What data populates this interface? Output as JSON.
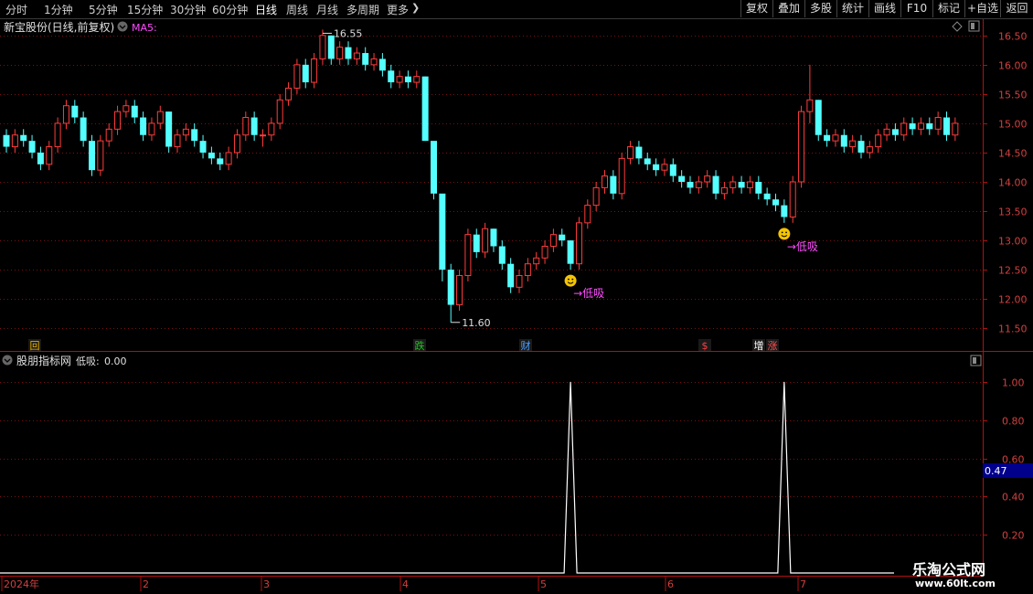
{
  "toolbar": {
    "periods": [
      "分时",
      "1分钟",
      "5分钟",
      "15分钟",
      "30分钟",
      "60分钟",
      "日线",
      "周线",
      "月线",
      "多周期",
      "更多"
    ],
    "active_period": "日线",
    "buttons": [
      "复权",
      "叠加",
      "多股",
      "统计",
      "画线",
      "F10",
      "标记",
      "+自选",
      "返回"
    ]
  },
  "main_chart": {
    "title": "新宝股份(日线,前复权)",
    "indicator": "MA5:",
    "high_label": "16.55",
    "low_label": "11.60",
    "signal_text": "低吸",
    "signal_arrow": "→",
    "price_ticks": [
      "16.50",
      "16.00",
      "15.50",
      "15.00",
      "14.50",
      "14.00",
      "13.50",
      "13.00",
      "12.50",
      "12.00",
      "11.50"
    ],
    "events": [
      {
        "text": "回",
        "color": "#e8b400"
      },
      {
        "text": "跌",
        "color": "#22c022"
      },
      {
        "text": "财",
        "color": "#4aa0ff"
      },
      {
        "text": "$",
        "color": "#ff4040"
      },
      {
        "text": "增",
        "color": "#ffffff"
      },
      {
        "text": "涨",
        "color": "#ff5050"
      }
    ]
  },
  "sub_chart": {
    "title": "股朋指标网",
    "indicator_label": "低吸:",
    "indicator_value": "0.00",
    "ticks": [
      "1.00",
      "0.80",
      "0.60",
      "0.40",
      "0.20"
    ],
    "current_value": "0.47"
  },
  "time_axis": {
    "labels": [
      "2024年",
      "2",
      "3",
      "4",
      "5",
      "6",
      "7"
    ]
  },
  "watermark": {
    "line1": "乐淘公式网",
    "line2": "www.60lt.com"
  },
  "chart_data": {
    "type": "candlestick",
    "security": "新宝股份",
    "period": "日线",
    "price_range": [
      11.3,
      16.7
    ],
    "up_color": "#ff3c3c",
    "down_color": "#54ffff",
    "candles": [
      [
        14.8,
        14.6,
        14.9,
        14.5
      ],
      [
        14.6,
        14.8,
        14.9,
        14.5
      ],
      [
        14.8,
        14.7,
        14.9,
        14.6
      ],
      [
        14.7,
        14.5,
        14.8,
        14.4
      ],
      [
        14.5,
        14.3,
        14.6,
        14.2
      ],
      [
        14.3,
        14.6,
        14.7,
        14.2
      ],
      [
        14.6,
        15.0,
        15.1,
        14.5
      ],
      [
        15.0,
        15.3,
        15.4,
        14.9
      ],
      [
        15.3,
        15.1,
        15.4,
        15.0
      ],
      [
        15.1,
        14.7,
        15.2,
        14.6
      ],
      [
        14.7,
        14.2,
        14.8,
        14.1
      ],
      [
        14.2,
        14.7,
        14.8,
        14.1
      ],
      [
        14.7,
        14.9,
        15.0,
        14.6
      ],
      [
        14.9,
        15.2,
        15.3,
        14.8
      ],
      [
        15.2,
        15.3,
        15.4,
        15.1
      ],
      [
        15.3,
        15.1,
        15.4,
        15.0
      ],
      [
        15.1,
        14.8,
        15.2,
        14.7
      ],
      [
        14.8,
        15.0,
        15.1,
        14.7
      ],
      [
        15.0,
        15.2,
        15.3,
        14.9
      ],
      [
        15.2,
        14.6,
        15.2,
        14.5
      ],
      [
        14.6,
        14.8,
        14.9,
        14.5
      ],
      [
        14.8,
        14.9,
        15.0,
        14.7
      ],
      [
        14.9,
        14.7,
        15.0,
        14.6
      ],
      [
        14.7,
        14.5,
        14.8,
        14.4
      ],
      [
        14.5,
        14.4,
        14.6,
        14.3
      ],
      [
        14.4,
        14.3,
        14.5,
        14.2
      ],
      [
        14.3,
        14.5,
        14.6,
        14.2
      ],
      [
        14.5,
        14.8,
        14.9,
        14.4
      ],
      [
        14.8,
        15.1,
        15.2,
        14.7
      ],
      [
        15.1,
        14.8,
        15.2,
        14.7
      ],
      [
        14.8,
        14.8,
        14.9,
        14.6
      ],
      [
        14.8,
        15.0,
        15.1,
        14.7
      ],
      [
        15.0,
        15.4,
        15.5,
        14.9
      ],
      [
        15.4,
        15.6,
        15.7,
        15.3
      ],
      [
        15.6,
        16.0,
        16.1,
        15.5
      ],
      [
        16.0,
        15.7,
        16.1,
        15.6
      ],
      [
        15.7,
        16.1,
        16.2,
        15.6
      ],
      [
        16.1,
        16.5,
        16.6,
        16.0
      ],
      [
        16.5,
        16.1,
        16.5,
        16.0
      ],
      [
        16.1,
        16.3,
        16.4,
        16.0
      ],
      [
        16.3,
        16.1,
        16.4,
        16.0
      ],
      [
        16.1,
        16.2,
        16.3,
        16.0
      ],
      [
        16.2,
        16.0,
        16.3,
        15.9
      ],
      [
        16.0,
        16.1,
        16.2,
        15.9
      ],
      [
        16.1,
        15.9,
        16.2,
        15.8
      ],
      [
        15.9,
        15.7,
        16.0,
        15.6
      ],
      [
        15.7,
        15.8,
        15.9,
        15.6
      ],
      [
        15.8,
        15.7,
        15.9,
        15.6
      ],
      [
        15.7,
        15.8,
        15.9,
        15.6
      ],
      [
        15.8,
        14.7,
        15.8,
        14.7
      ],
      [
        14.7,
        13.8,
        14.3,
        13.7
      ],
      [
        13.8,
        12.5,
        13.6,
        12.3
      ],
      [
        12.5,
        11.9,
        12.6,
        11.6
      ],
      [
        11.9,
        12.4,
        12.5,
        11.8
      ],
      [
        12.4,
        13.1,
        13.2,
        12.3
      ],
      [
        13.1,
        12.8,
        13.2,
        12.7
      ],
      [
        12.8,
        13.2,
        13.3,
        12.7
      ],
      [
        13.2,
        12.9,
        13.2,
        12.8
      ],
      [
        12.9,
        12.6,
        13.0,
        12.5
      ],
      [
        12.6,
        12.2,
        12.7,
        12.1
      ],
      [
        12.2,
        12.4,
        12.5,
        12.1
      ],
      [
        12.4,
        12.6,
        12.7,
        12.3
      ],
      [
        12.6,
        12.7,
        12.8,
        12.5
      ],
      [
        12.7,
        12.9,
        13.0,
        12.6
      ],
      [
        12.9,
        13.1,
        13.2,
        12.8
      ],
      [
        13.1,
        13.0,
        13.2,
        12.9
      ],
      [
        13.0,
        12.6,
        13.0,
        12.5
      ],
      [
        12.6,
        13.3,
        13.4,
        12.5
      ],
      [
        13.3,
        13.6,
        13.7,
        13.2
      ],
      [
        13.6,
        13.9,
        14.0,
        13.5
      ],
      [
        13.9,
        14.1,
        14.2,
        13.8
      ],
      [
        14.1,
        13.8,
        14.2,
        13.7
      ],
      [
        13.8,
        14.4,
        14.5,
        13.7
      ],
      [
        14.4,
        14.6,
        14.7,
        14.3
      ],
      [
        14.6,
        14.4,
        14.7,
        14.3
      ],
      [
        14.4,
        14.3,
        14.5,
        14.2
      ],
      [
        14.3,
        14.2,
        14.4,
        14.1
      ],
      [
        14.2,
        14.3,
        14.4,
        14.1
      ],
      [
        14.3,
        14.1,
        14.4,
        14.0
      ],
      [
        14.1,
        14.0,
        14.2,
        13.9
      ],
      [
        14.0,
        13.9,
        14.1,
        13.8
      ],
      [
        13.9,
        14.0,
        14.1,
        13.8
      ],
      [
        14.0,
        14.1,
        14.2,
        13.9
      ],
      [
        14.1,
        13.8,
        14.2,
        13.7
      ],
      [
        13.8,
        13.9,
        14.0,
        13.7
      ],
      [
        13.9,
        14.0,
        14.1,
        13.8
      ],
      [
        14.0,
        13.9,
        14.1,
        13.8
      ],
      [
        13.9,
        14.0,
        14.1,
        13.8
      ],
      [
        14.0,
        13.8,
        14.1,
        13.7
      ],
      [
        13.8,
        13.7,
        13.9,
        13.6
      ],
      [
        13.7,
        13.6,
        13.8,
        13.5
      ],
      [
        13.6,
        13.4,
        13.7,
        13.3
      ],
      [
        13.4,
        14.0,
        14.1,
        13.3
      ],
      [
        14.0,
        15.2,
        15.3,
        13.9
      ],
      [
        15.2,
        15.4,
        16.0,
        15.0
      ],
      [
        15.4,
        14.8,
        15.4,
        14.7
      ],
      [
        14.8,
        14.7,
        14.9,
        14.6
      ],
      [
        14.7,
        14.8,
        14.9,
        14.6
      ],
      [
        14.8,
        14.6,
        14.9,
        14.5
      ],
      [
        14.6,
        14.7,
        14.8,
        14.5
      ],
      [
        14.7,
        14.5,
        14.8,
        14.4
      ],
      [
        14.5,
        14.6,
        14.7,
        14.4
      ],
      [
        14.6,
        14.8,
        14.9,
        14.5
      ],
      [
        14.8,
        14.9,
        15.0,
        14.7
      ],
      [
        14.9,
        14.8,
        15.0,
        14.7
      ],
      [
        14.8,
        15.0,
        15.1,
        14.7
      ],
      [
        15.0,
        14.9,
        15.1,
        14.8
      ],
      [
        14.9,
        15.0,
        15.1,
        14.8
      ],
      [
        15.0,
        14.9,
        15.1,
        14.8
      ],
      [
        14.9,
        15.1,
        15.2,
        14.8
      ],
      [
        15.1,
        14.8,
        15.2,
        14.7
      ],
      [
        14.8,
        15.0,
        15.1,
        14.7
      ]
    ],
    "signal_candles": [
      66,
      91
    ],
    "extremes": {
      "high": 16.55,
      "low": 11.6
    },
    "indicator_series": {
      "name": "低吸",
      "range": [
        0,
        1.1
      ],
      "points_at": [
        66,
        91
      ],
      "value_at_points": 1.0,
      "baseline": 0.0
    }
  }
}
